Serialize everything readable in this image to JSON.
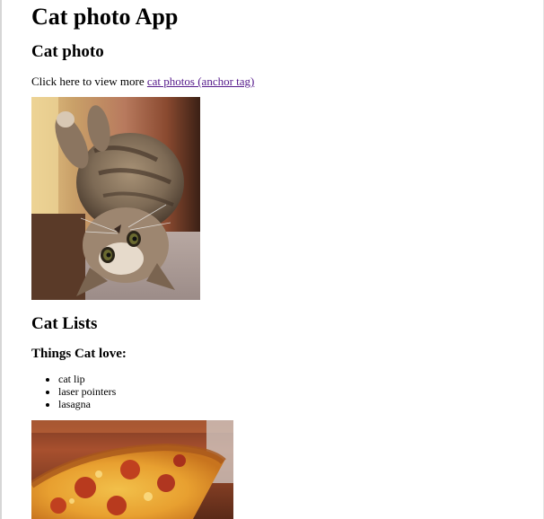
{
  "page": {
    "title": "Cat photo App",
    "section_photo": {
      "heading": "Cat photo",
      "intro_text": "Click here to view more ",
      "link_text": "cat photos (anchor tag)",
      "image_alt": "cat photo"
    },
    "section_lists": {
      "heading": "Cat Lists",
      "subheading": "Things Cat love:",
      "items": [
        "cat lip",
        "laser pointers",
        "lasagna"
      ],
      "image_alt": "pizza photo"
    }
  }
}
